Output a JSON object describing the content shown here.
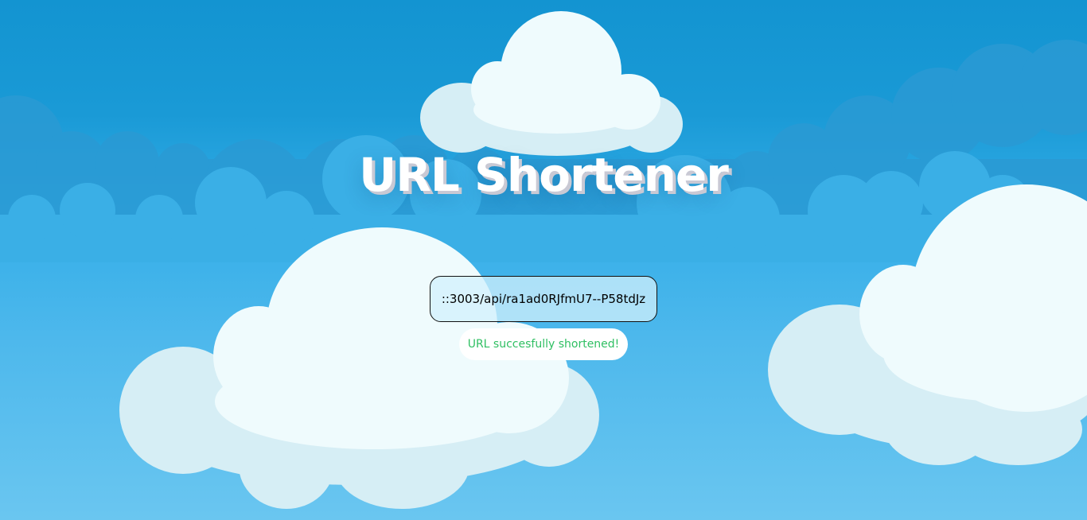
{
  "header": {
    "title": "URL Shortener"
  },
  "shortener": {
    "result_url": "::3003/api/ra1ad0RJfmU7--P58tdJz",
    "status_message": "URL succesfully shortened!"
  },
  "colors": {
    "sky_top": "#1394d1",
    "sky_bottom": "#6ac6f0",
    "cloud_white": "#effbfd",
    "cloud_shade": "#d6eef5",
    "success_green": "#2fbf62"
  }
}
